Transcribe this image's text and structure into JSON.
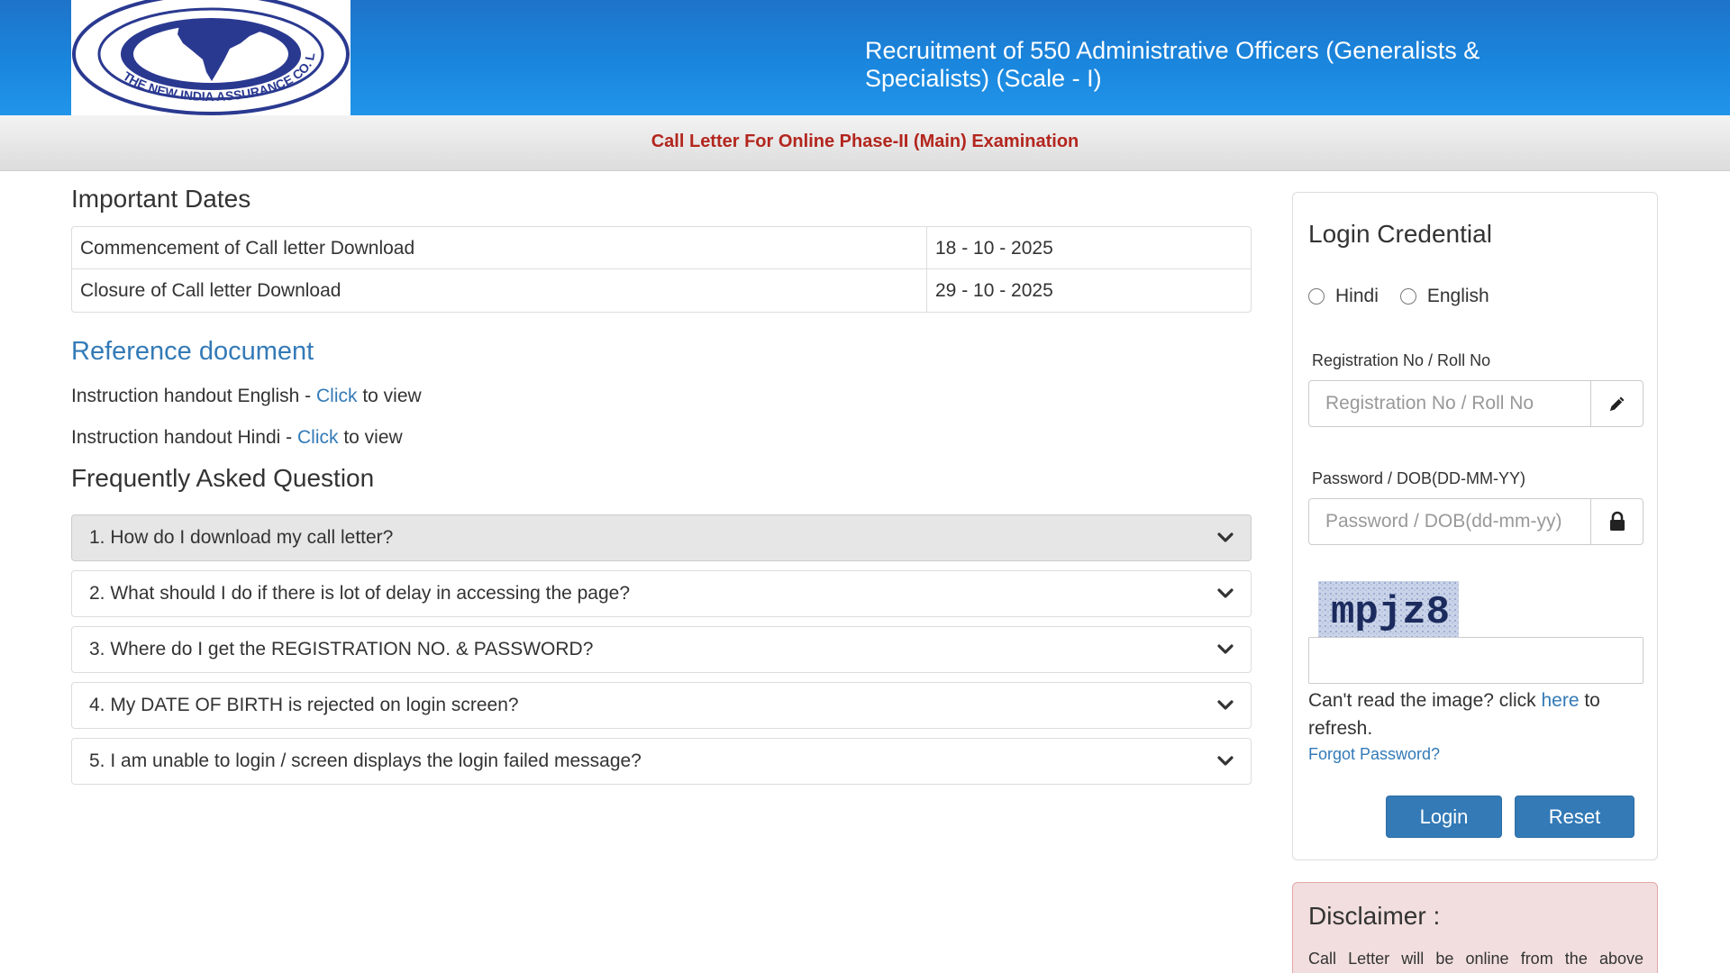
{
  "header": {
    "title": "Recruitment of 550 Administrative Officers (Generalists & Specialists) (Scale - I)",
    "logo_text": "THE NEW INDIA ASSURANCE CO. LTD.",
    "brand_color": "#1a86dd"
  },
  "subbar": {
    "text": "Call Letter For Online Phase-II (Main) Examination"
  },
  "important_dates": {
    "title": "Important Dates",
    "rows": [
      {
        "label": "Commencement of Call letter Download",
        "value": "18 - 10 - 2025"
      },
      {
        "label": "Closure of Call letter Download",
        "value": "29 - 10 - 2025"
      }
    ]
  },
  "reference": {
    "title": "Reference document",
    "items": [
      {
        "prefix": "Instruction handout English - ",
        "link": "Click",
        "suffix": " to view"
      },
      {
        "prefix": "Instruction handout Hindi - ",
        "link": "Click",
        "suffix": " to view"
      }
    ]
  },
  "faq": {
    "title": "Frequently Asked Question",
    "items": [
      "1. How do I download my call letter?",
      "2. What should I do if there is lot of delay in accessing the page?",
      "3. Where do I get the REGISTRATION NO. & PASSWORD?",
      "4. My DATE OF BIRTH is rejected on login screen?",
      "5. I am unable to login / screen displays the login failed message?"
    ]
  },
  "login": {
    "title": "Login Credential",
    "languages": [
      "Hindi",
      "English"
    ],
    "reg_label": "Registration No / Roll No",
    "reg_placeholder": "Registration No / Roll No",
    "pwd_label": "Password / DOB(DD-MM-YY)",
    "pwd_placeholder": "Password / DOB(dd-mm-yy)",
    "captcha_text": "mpjz8",
    "captcha_help_prefix": "Can't read the image? click ",
    "captcha_help_link": "here",
    "captcha_help_suffix": " to refresh.",
    "forgot": "Forgot Password?",
    "login_btn": "Login",
    "reset_btn": "Reset",
    "accent_color": "#337ab7"
  },
  "disclaimer": {
    "title": "Disclaimer :",
    "text": "Call Letter will be online from the above"
  }
}
